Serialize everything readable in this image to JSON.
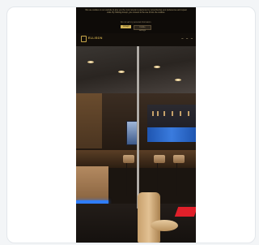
{
  "preview": {
    "cookie_banner": {
      "text": "We use cookies on our website to give you the most relevant experience by remembering your preferences and repeat visits. By clicking Accept, you consent to the use of ALL the cookies.",
      "link": "Do not sell my personal information.",
      "accept_label": "Accept",
      "settings_label": "Cookie settings"
    },
    "header": {
      "logo_text": "ELLISON"
    }
  },
  "colors": {
    "accent": "#c9a84a",
    "banner_bg": "#0e0b08",
    "shelf_glow": "#3f8cff",
    "carpet": "#e0202a"
  }
}
